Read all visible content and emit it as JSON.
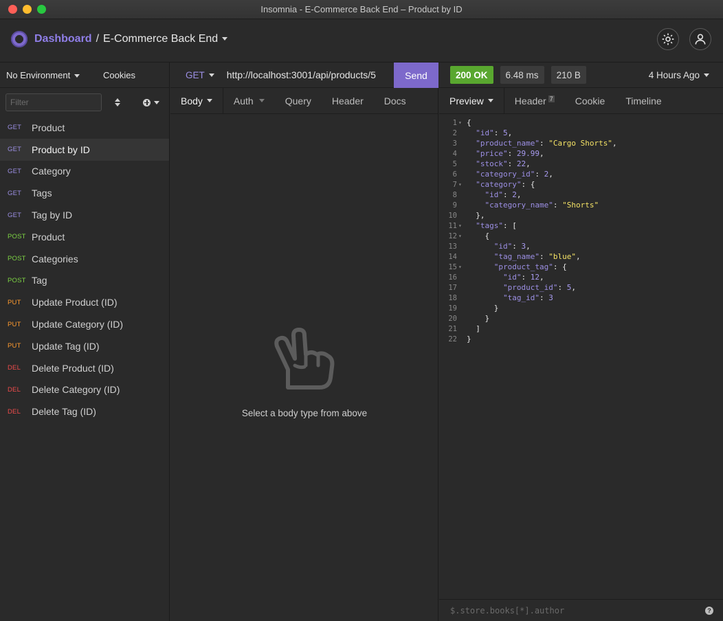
{
  "window": {
    "title": "Insomnia - E-Commerce Back End – Product by ID"
  },
  "header": {
    "dashboard": "Dashboard",
    "separator": "/",
    "project": "E-Commerce Back End"
  },
  "sidebar": {
    "environment": "No Environment",
    "cookies": "Cookies",
    "filter_placeholder": "Filter",
    "requests": [
      {
        "method": "GET",
        "name": "Product"
      },
      {
        "method": "GET",
        "name": "Product by ID"
      },
      {
        "method": "GET",
        "name": "Category"
      },
      {
        "method": "GET",
        "name": "Tags"
      },
      {
        "method": "GET",
        "name": "Tag by ID"
      },
      {
        "method": "POST",
        "name": "Product"
      },
      {
        "method": "POST",
        "name": "Categories"
      },
      {
        "method": "POST",
        "name": "Tag"
      },
      {
        "method": "PUT",
        "name": "Update Product (ID)"
      },
      {
        "method": "PUT",
        "name": "Update Category (ID)"
      },
      {
        "method": "PUT",
        "name": "Update Tag (ID)"
      },
      {
        "method": "DEL",
        "name": "Delete Product (ID)"
      },
      {
        "method": "DEL",
        "name": "Delete Category (ID)"
      },
      {
        "method": "DEL",
        "name": "Delete Tag (ID)"
      }
    ]
  },
  "request": {
    "method": "GET",
    "url": "http://localhost:3001/api/products/5",
    "send_label": "Send",
    "tabs": [
      "Body",
      "Auth",
      "Query",
      "Header",
      "Docs"
    ],
    "empty_message": "Select a body type from above"
  },
  "response": {
    "status": "200 OK",
    "time": "6.48 ms",
    "size": "210 B",
    "age": "4 Hours Ago",
    "tabs": [
      "Preview",
      "Header",
      "Cookie",
      "Timeline"
    ],
    "header_count": "7",
    "filter_placeholder": "$.store.books[*].author",
    "body_lines": [
      "{",
      "  \"id\": 5,",
      "  \"product_name\": \"Cargo Shorts\",",
      "  \"price\": 29.99,",
      "  \"stock\": 22,",
      "  \"category_id\": 2,",
      "  \"category\": {",
      "    \"id\": 2,",
      "    \"category_name\": \"Shorts\"",
      "  },",
      "  \"tags\": [",
      "    {",
      "      \"id\": 3,",
      "      \"tag_name\": \"blue\",",
      "      \"product_tag\": {",
      "        \"id\": 12,",
      "        \"product_id\": 5,",
      "        \"tag_id\": 3",
      "      }",
      "    }",
      "  ]",
      "}"
    ],
    "fold_lines": [
      1,
      7,
      11,
      12,
      15
    ]
  },
  "colors": {
    "accent": "#7d69cb",
    "ok": "#59a72f",
    "get": "#9c8fe4",
    "post": "#7dd444",
    "put": "#ff9b2f",
    "del": "#ef4b4b",
    "json_key": "#9c8fe4",
    "json_string": "#f4e265"
  }
}
